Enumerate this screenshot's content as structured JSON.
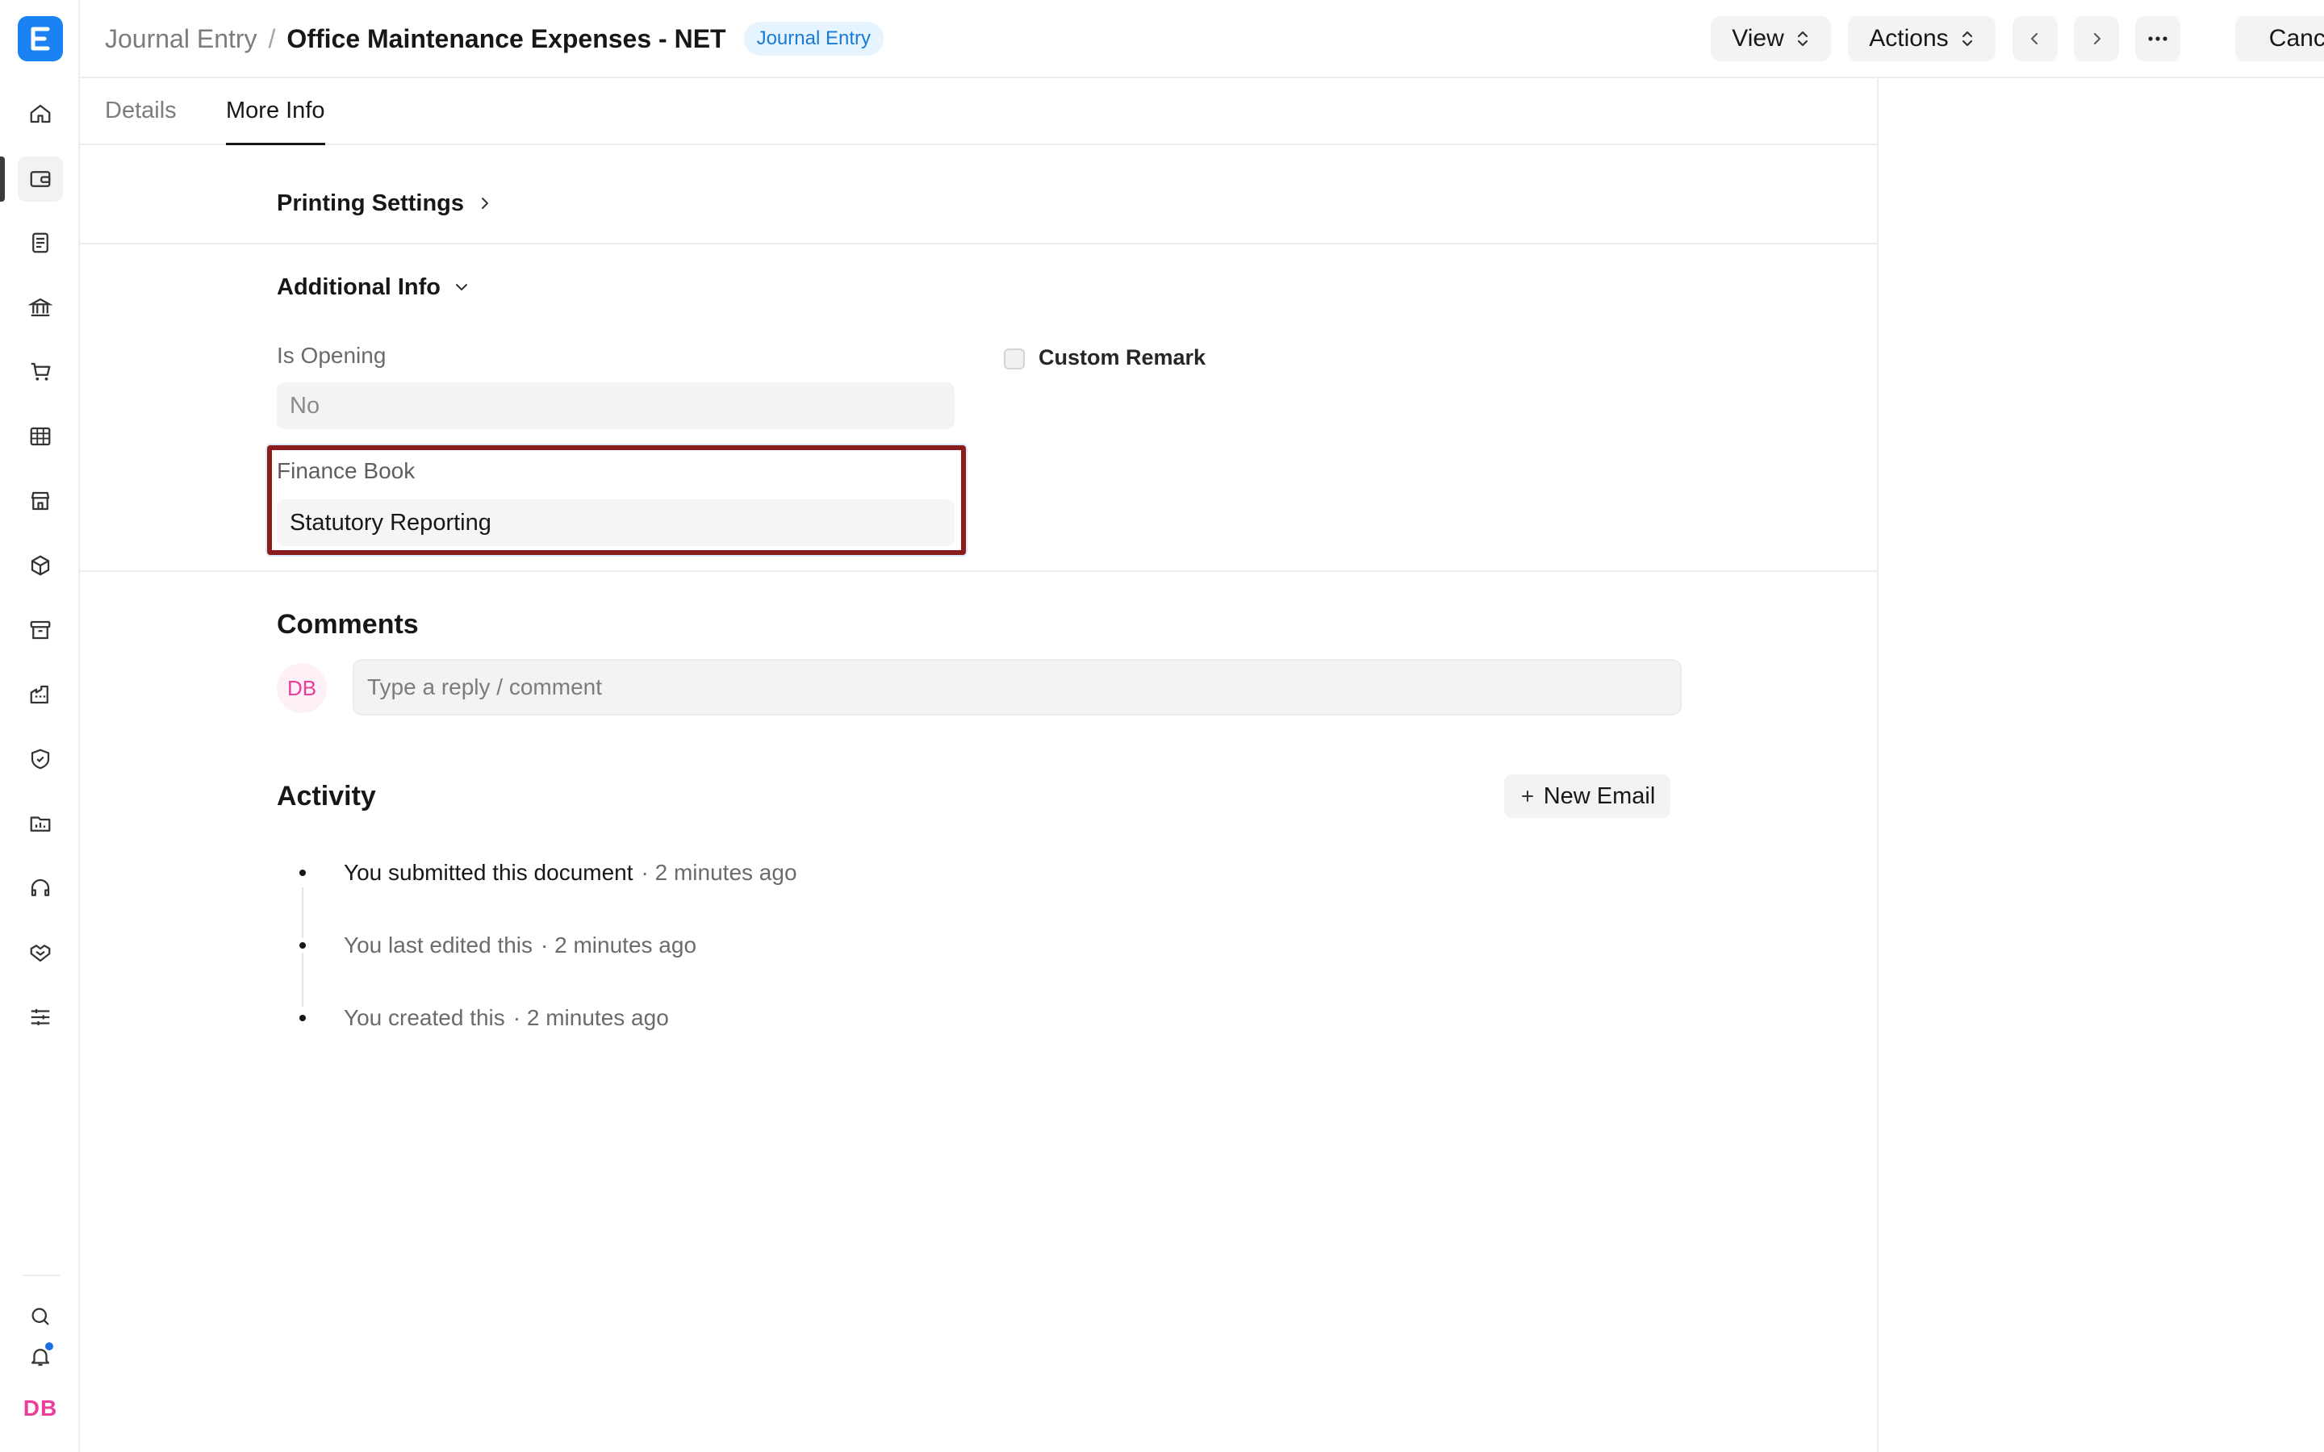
{
  "breadcrumb": {
    "parent": "Journal Entry",
    "separator": "/",
    "current": "Office Maintenance Expenses - NET",
    "badge": "Journal Entry"
  },
  "header_actions": {
    "view_label": "View",
    "actions_label": "Actions",
    "cancel_label": "Cancel"
  },
  "tabs": [
    {
      "label": "Details",
      "active": false
    },
    {
      "label": "More Info",
      "active": true
    }
  ],
  "sections": {
    "printing_settings": {
      "title": "Printing Settings",
      "expanded": false
    },
    "additional_info": {
      "title": "Additional Info",
      "expanded": true,
      "is_opening": {
        "label": "Is Opening",
        "value": "No"
      },
      "custom_remark": {
        "label": "Custom Remark",
        "checked": false
      },
      "finance_book": {
        "label": "Finance Book",
        "value": "Statutory Reporting"
      }
    }
  },
  "comments": {
    "title": "Comments",
    "avatar_initials": "DB",
    "placeholder": "Type a reply / comment"
  },
  "activity": {
    "title": "Activity",
    "new_email_label": "New Email",
    "items": [
      {
        "text": "You submitted this document",
        "time": "· 2 minutes ago"
      },
      {
        "text": "You last edited this",
        "time": "· 2 minutes ago"
      },
      {
        "text": "You created this",
        "time": "· 2 minutes ago"
      }
    ]
  },
  "sidebar": {
    "icons": [
      "home-icon",
      "wallet-icon",
      "document-icon",
      "bank-icon",
      "cart-icon",
      "table-icon",
      "store-icon",
      "package-icon",
      "archive-icon",
      "building-icon",
      "shield-icon",
      "folder-chart-icon",
      "headset-icon",
      "handshake-icon",
      "sliders-icon"
    ],
    "active_index": 1,
    "user_initials": "DB"
  },
  "colors": {
    "brand": "#1a82f2",
    "highlight_border": "#8a1c1c",
    "badge_bg": "#e6f4ff",
    "badge_text": "#1a7ad8",
    "avatar_text": "#e93e9a"
  }
}
